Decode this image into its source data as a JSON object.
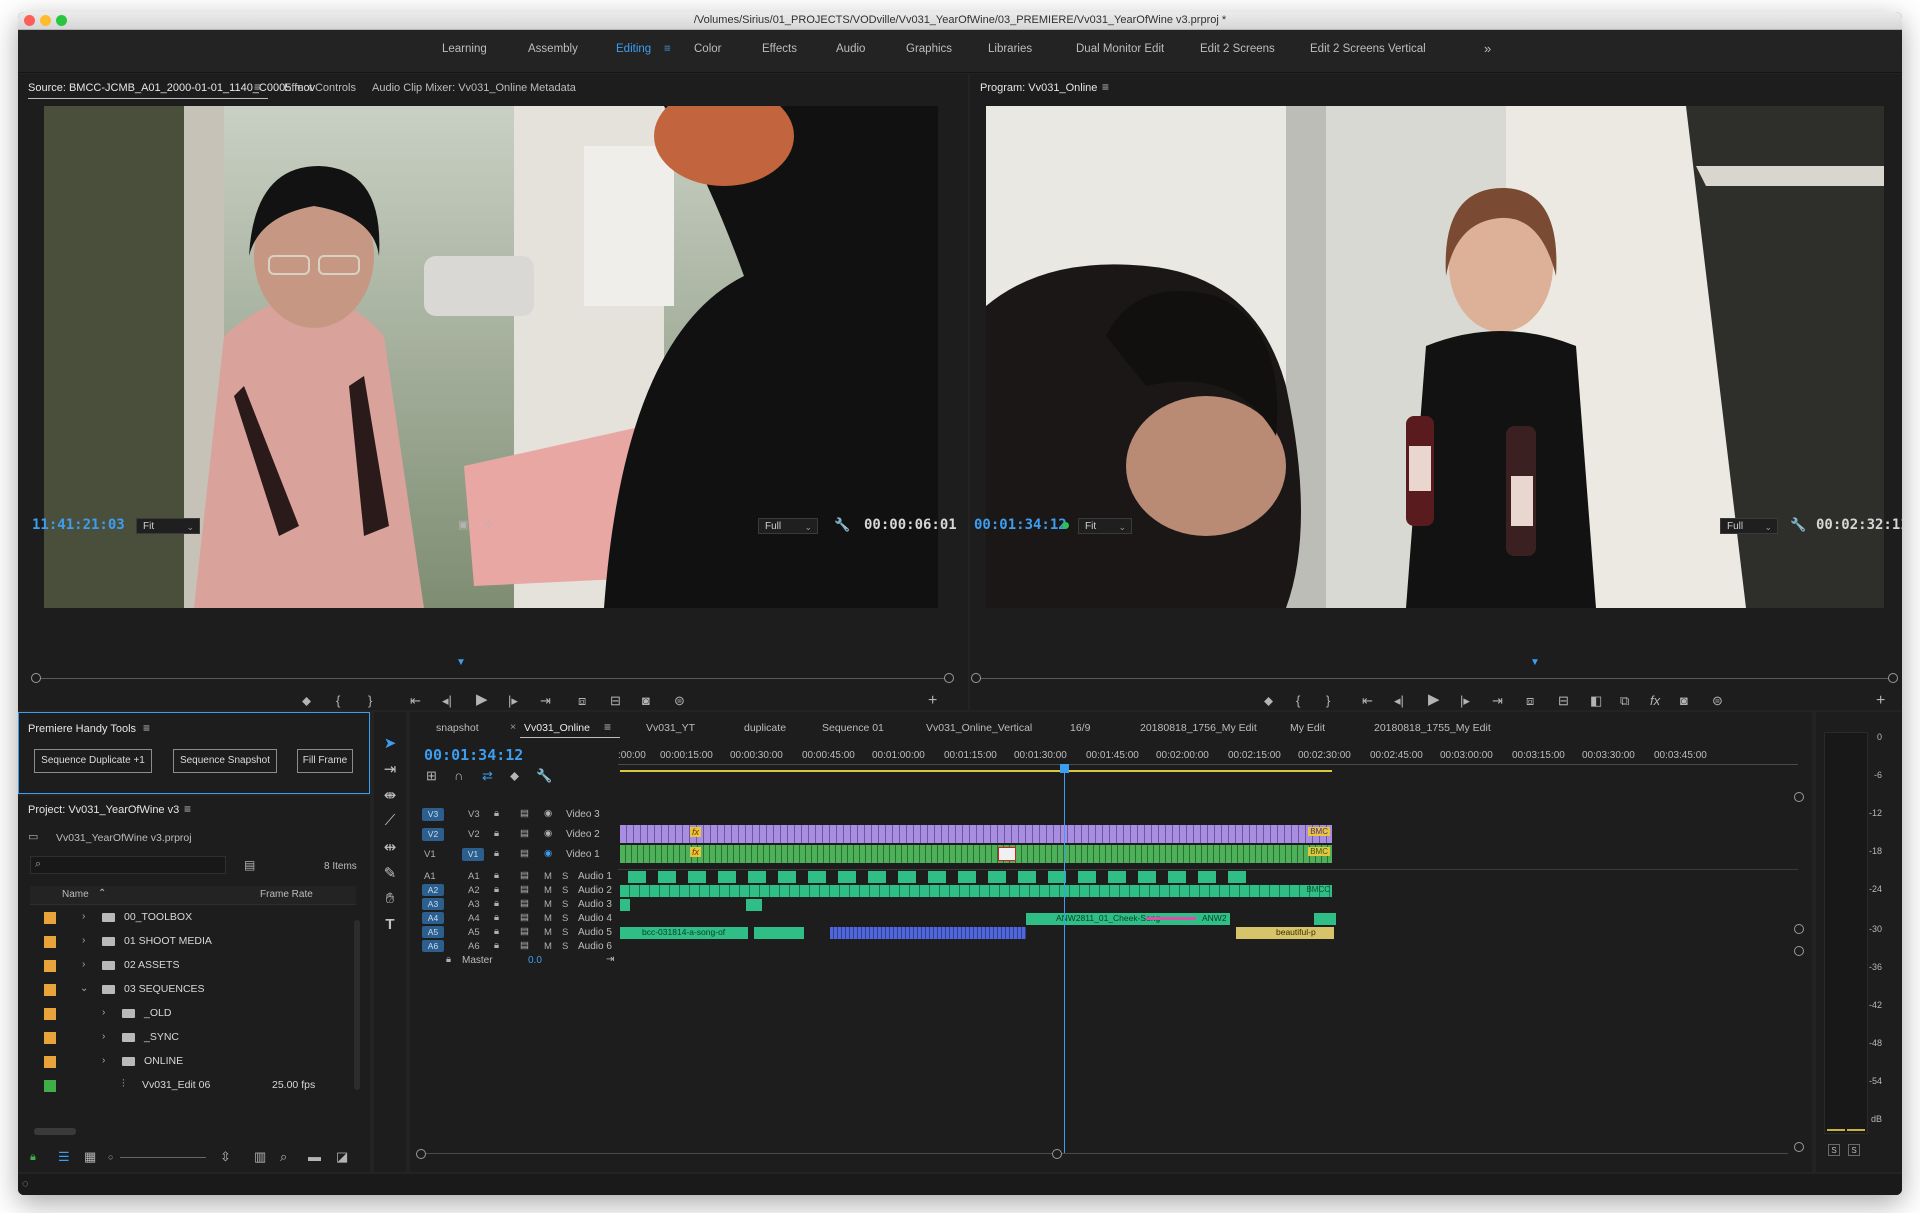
{
  "window": {
    "title": "/Volumes/Sirius/01_PROJECTS/VODville/Vv031_YearOfWine/03_PREMIERE/Vv031_YearOfWine v3.prproj *"
  },
  "workspaces": {
    "items": [
      "Learning",
      "Assembly",
      "Editing",
      "Color",
      "Effects",
      "Audio",
      "Graphics",
      "Libraries",
      "Dual Monitor Edit",
      "Edit 2 Screens",
      "Edit 2 Screens Vertical"
    ],
    "active": "Editing",
    "overflow_icon": "chevron-double-right-icon"
  },
  "source": {
    "tabs": [
      "Source: BMCC-JCMB_A01_2000-01-01_1140_C0005.mov",
      "Effect Controls",
      "Audio Clip Mixer: Vv031_Online",
      "Metadata"
    ],
    "timecode": "11:41:21:03",
    "fit": "Fit",
    "quality": "Full",
    "duration": "00:00:06:01"
  },
  "program": {
    "tab": "Program: Vv031_Online",
    "timecode": "00:01:34:12",
    "fit": "Fit",
    "quality": "Full",
    "duration": "00:02:32:11"
  },
  "handy_tools": {
    "title": "Premiere Handy Tools",
    "buttons": [
      "Sequence Duplicate +1",
      "Sequence Snapshot",
      "Fill Frame"
    ]
  },
  "project": {
    "title": "Project: Vv031_YearOfWine v3",
    "file": "Vv031_YearOfWine v3.prproj",
    "item_count": "8 Items",
    "col_name": "Name",
    "col_rate": "Frame Rate",
    "rows": [
      {
        "name": "00_TOOLBOX",
        "rate": "",
        "color": "#e8a33a"
      },
      {
        "name": "01 SHOOT MEDIA",
        "rate": "",
        "color": "#e8a33a"
      },
      {
        "name": "02 ASSETS",
        "rate": "",
        "color": "#e8a33a"
      },
      {
        "name": "03 SEQUENCES",
        "rate": "",
        "color": "#e8a33a"
      },
      {
        "name": "_OLD",
        "rate": "",
        "color": "#e8a33a"
      },
      {
        "name": "_SYNC",
        "rate": "",
        "color": "#e8a33a"
      },
      {
        "name": "ONLINE",
        "rate": "",
        "color": "#e8a33a"
      },
      {
        "name": "Vv031_Edit 06",
        "rate": "25.00 fps",
        "color": "#3fae49"
      }
    ]
  },
  "timeline": {
    "tabs": [
      "snapshot",
      "Vv031_Online",
      "Vv031_YT",
      "duplicate",
      "Sequence 01",
      "Vv031_Online_Vertical",
      "16/9",
      "20180818_1756_My Edit",
      "My Edit",
      "20180818_1755_My Edit"
    ],
    "active_tab": "Vv031_Online",
    "timecode": "00:01:34:12",
    "ruler": [
      ":00:00",
      "00:00:15:00",
      "00:00:30:00",
      "00:00:45:00",
      "00:01:00:00",
      "00:01:15:00",
      "00:01:30:00",
      "00:01:45:00",
      "00:02:00:00",
      "00:02:15:00",
      "00:02:30:00",
      "00:02:45:00",
      "00:03:00:00",
      "00:03:15:00",
      "00:03:30:00",
      "00:03:45:00"
    ],
    "video_tracks": [
      {
        "src": "V3",
        "id": "V3",
        "name": "Video 3"
      },
      {
        "src": "V2",
        "id": "V2",
        "name": "Video 2"
      },
      {
        "src": "V1",
        "id": "V1",
        "name": "Video 1"
      }
    ],
    "audio_tracks": [
      {
        "src": "A1",
        "id": "A1",
        "name": "Audio 1"
      },
      {
        "src": "A2",
        "id": "A2",
        "name": "Audio 2"
      },
      {
        "src": "A3",
        "id": "A3",
        "name": "Audio 3"
      },
      {
        "src": "A4",
        "id": "A4",
        "name": "Audio 4"
      },
      {
        "src": "A5",
        "id": "A5",
        "name": "Audio 5"
      },
      {
        "src": "A6",
        "id": "A6",
        "name": "Audio 6"
      }
    ],
    "master_label": "Master",
    "master_value": "0.0",
    "clip_labels": {
      "v2_end": "BMC",
      "v1_end": "BMC",
      "a2_end": "BMCC",
      "a4_a": "ANW2811_01_Cheek-Song",
      "a4_b": "ANW2",
      "a5_a": "bcc-031814-a-song-of",
      "a5_b": "beautiful-p"
    }
  },
  "meter": {
    "scale": [
      "0",
      "-6",
      "-12",
      "-18",
      "-24",
      "-30",
      "-36",
      "-42",
      "-48",
      "-54",
      "dB"
    ],
    "solo": [
      "S",
      "S"
    ]
  },
  "colors": {
    "accent": "#3c9ef0",
    "video_clip": "#a98de0",
    "video_clip_v1": "#4fb05a",
    "audio_clip": "#2fbf86",
    "audio_clip_alt": "#d6c36a",
    "audio_clip_blue": "#5166d8",
    "folder_label": "#e8a33a",
    "sequence_label": "#3fae49"
  }
}
